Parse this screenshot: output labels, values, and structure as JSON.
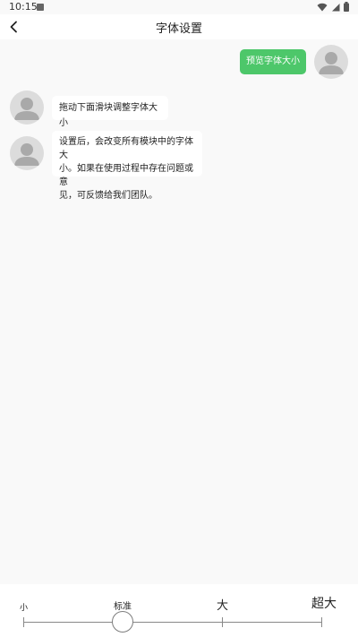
{
  "status_bar": {
    "time": "10:15"
  },
  "app_bar": {
    "title": "字体设置"
  },
  "chat": {
    "preview_message": "预览字体大小",
    "messages": [
      {
        "lines": [
          "拖动下面滑块调整字体大小"
        ]
      },
      {
        "lines": [
          "设置后，会改变所有模块中的字体大",
          "小。如果在使用过程中存在问题或意",
          "见，可反馈给我们团队。"
        ]
      }
    ]
  },
  "slider": {
    "labels": [
      "小",
      "标准",
      "大",
      "超大"
    ],
    "selected_index": 1
  },
  "colors": {
    "accent_green": "#4dc76a",
    "background": "#f9f9f9"
  }
}
